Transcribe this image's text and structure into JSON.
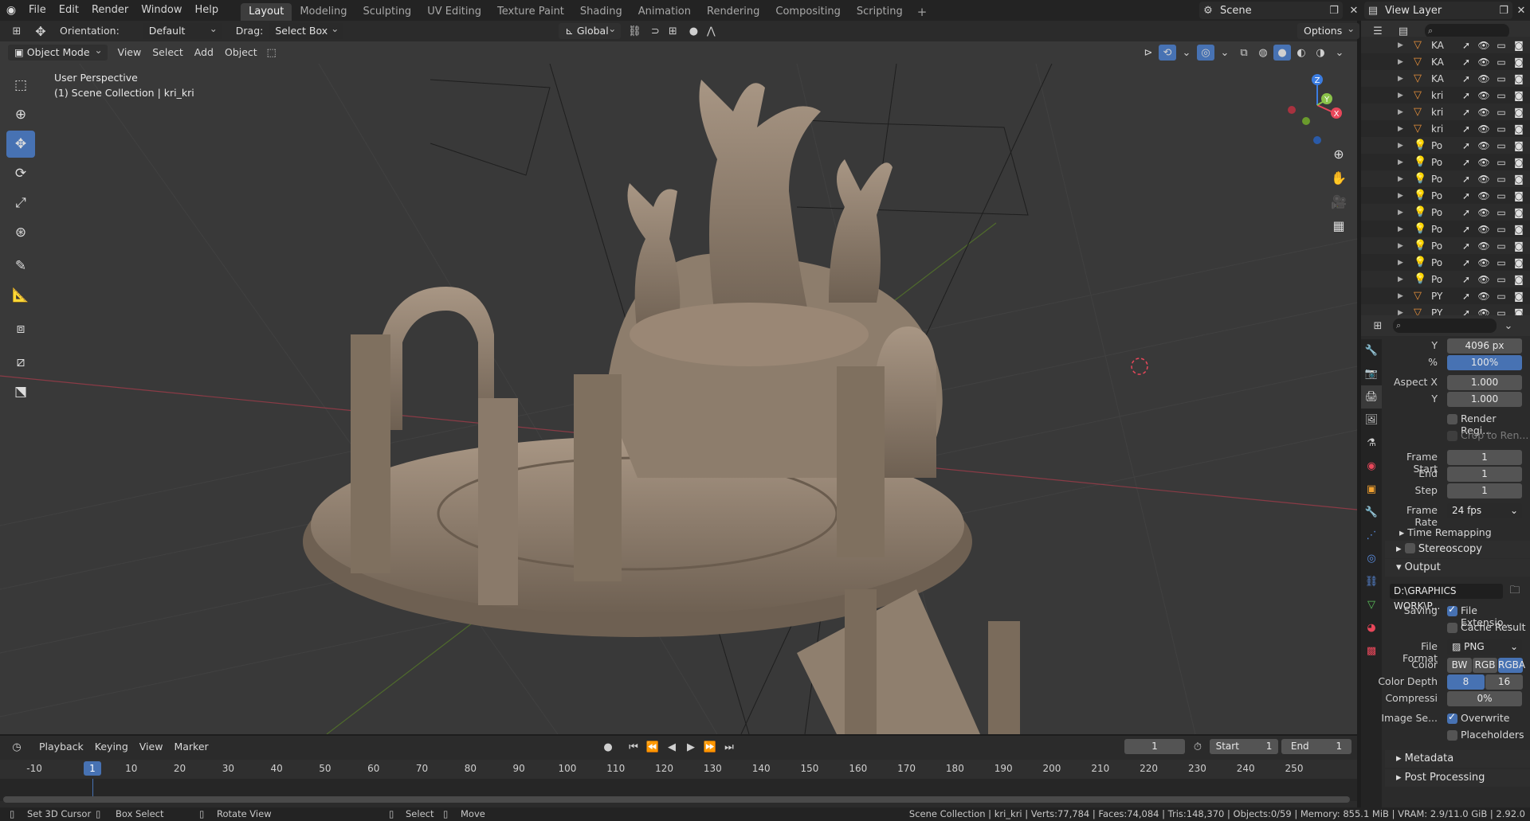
{
  "menu": [
    "File",
    "Edit",
    "Render",
    "Window",
    "Help"
  ],
  "workspaces": [
    {
      "label": "Layout",
      "active": true
    },
    {
      "label": "Modeling"
    },
    {
      "label": "Sculpting"
    },
    {
      "label": "UV Editing"
    },
    {
      "label": "Texture Paint"
    },
    {
      "label": "Shading"
    },
    {
      "label": "Animation"
    },
    {
      "label": "Rendering"
    },
    {
      "label": "Compositing"
    },
    {
      "label": "Scripting"
    }
  ],
  "scene": {
    "name": "Scene",
    "view_layer": "View Layer"
  },
  "tool_header": {
    "orientation_label": "Orientation:",
    "orientation_value": "Default",
    "drag_label": "Drag:",
    "drag_value": "Select Box",
    "transform_orientation": "Global",
    "options_label": "Options"
  },
  "viewport_header": {
    "mode": "Object Mode",
    "menus": [
      "View",
      "Select",
      "Add",
      "Object"
    ]
  },
  "viewport": {
    "perspective": "User Perspective",
    "collection": "(1) Scene Collection | kri_kri"
  },
  "gizmo": {
    "x": "X",
    "y": "Y",
    "z": "Z"
  },
  "outliner": {
    "rows": [
      {
        "name": "KA",
        "type": "mesh"
      },
      {
        "name": "KA",
        "type": "mesh"
      },
      {
        "name": "KA",
        "type": "mesh"
      },
      {
        "name": "kri",
        "type": "mesh"
      },
      {
        "name": "kri",
        "type": "mesh"
      },
      {
        "name": "kri",
        "type": "mesh"
      },
      {
        "name": "Po",
        "type": "light"
      },
      {
        "name": "Po",
        "type": "light"
      },
      {
        "name": "Po",
        "type": "light"
      },
      {
        "name": "Po",
        "type": "light"
      },
      {
        "name": "Po",
        "type": "light"
      },
      {
        "name": "Po",
        "type": "light"
      },
      {
        "name": "Po",
        "type": "light"
      },
      {
        "name": "Po",
        "type": "light"
      },
      {
        "name": "Po",
        "type": "light"
      },
      {
        "name": "PY",
        "type": "mesh"
      },
      {
        "name": "PY",
        "type": "mesh"
      }
    ]
  },
  "properties": {
    "res_y_label": "Y",
    "res_y": "4096 px",
    "percent_label": "%",
    "percent": "100%",
    "aspect_x_label": "Aspect X",
    "aspect_x": "1.000",
    "aspect_y_label": "Y",
    "aspect_y": "1.000",
    "render_region": "Render Regi...",
    "crop_to_render": "Crop to Ren...",
    "frame_start_label": "Frame Start",
    "frame_start": "1",
    "end_label": "End",
    "end": "1",
    "step_label": "Step",
    "step": "1",
    "frame_rate_label": "Frame Rate",
    "frame_rate": "24 fps",
    "time_remapping": "Time Remapping",
    "stereoscopy": "Stereoscopy",
    "output": "Output",
    "output_path": "D:\\GRAPHICS WORK\\P...",
    "saving_label": "Saving",
    "file_extensions": "File Extensio...",
    "cache_result": "Cache Result",
    "file_format_label": "File Format",
    "file_format": "PNG",
    "color_label": "Color",
    "color_options": [
      "BW",
      "RGB",
      "RGBA"
    ],
    "color_selected": "RGBA",
    "color_depth_label": "Color Depth",
    "color_depth_options": [
      "8",
      "16"
    ],
    "compression_label": "Compressi",
    "compression": "0%",
    "image_seq_label": "Image Se...",
    "overwrite": "Overwrite",
    "placeholders": "Placeholders",
    "metadata": "Metadata",
    "post_processing": "Post Processing"
  },
  "timeline": {
    "menus": [
      "Playback",
      "Keying",
      "View",
      "Marker"
    ],
    "current_frame": "1",
    "start_label": "Start",
    "start": "1",
    "end_label": "End",
    "end": "1",
    "ruler": [
      "-10",
      "1",
      "10",
      "20",
      "30",
      "40",
      "50",
      "60",
      "70",
      "80",
      "90",
      "100",
      "110",
      "120",
      "130",
      "140",
      "150",
      "160",
      "170",
      "180",
      "190",
      "200",
      "210",
      "220",
      "230",
      "240",
      "250"
    ]
  },
  "statusbar": {
    "hint1": "Set 3D Cursor",
    "hint2": "Box Select",
    "hint3": "Rotate View",
    "hint4": "Select",
    "hint5": "Move",
    "info": "Scene Collection | kri_kri | Verts:77,784 | Faces:74,084 | Tris:148,370 | Objects:0/59 | Memory: 855.1 MiB | VRAM: 2.9/11.0 GiB | 2.92.0"
  },
  "colors": {
    "accent": "#4772b3",
    "axis_x": "#e8475a",
    "axis_y": "#8bc34a",
    "axis_z": "#3b7ce0",
    "mesh": "#8a7a6a"
  }
}
